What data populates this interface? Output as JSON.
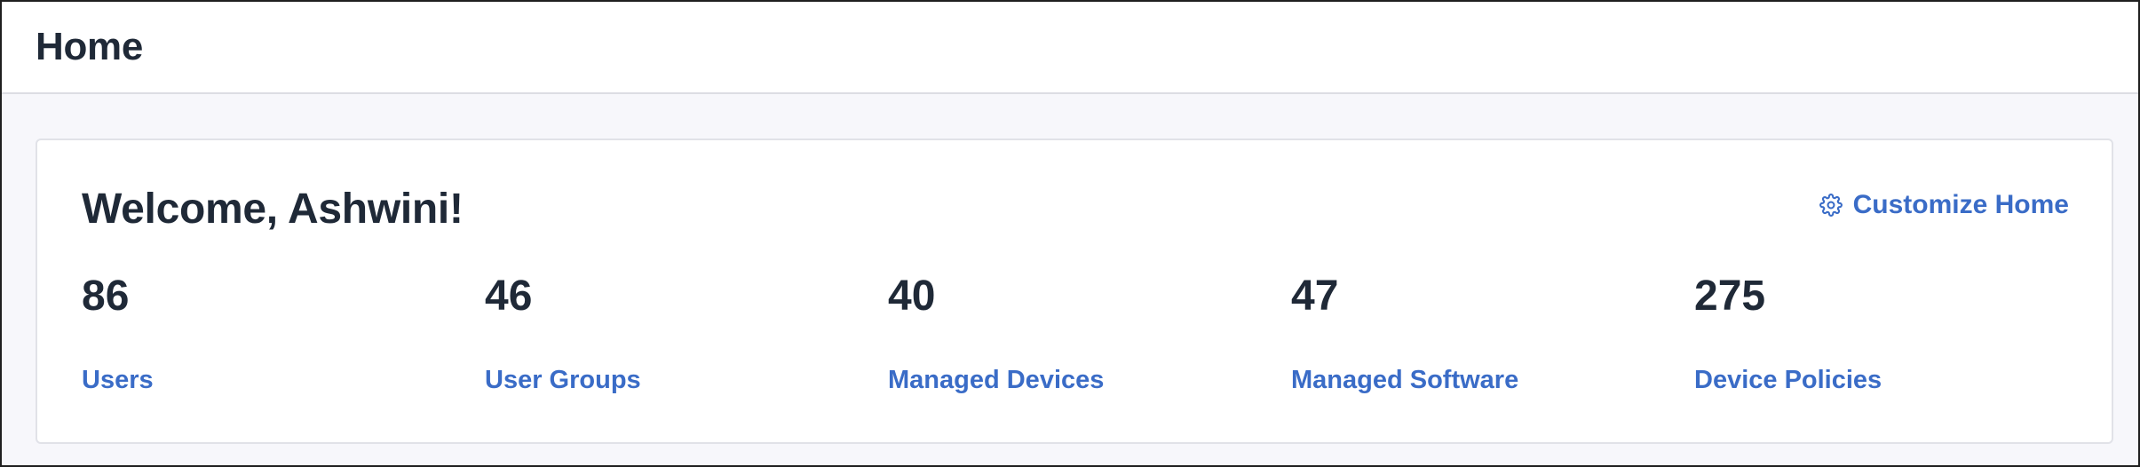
{
  "header": {
    "title": "Home"
  },
  "welcome_card": {
    "greeting": "Welcome, Ashwini!",
    "customize_label": "Customize Home",
    "customize_icon": "gear-icon",
    "accent_color": "#3a6cc7",
    "stats": [
      {
        "value": "86",
        "label": "Users"
      },
      {
        "value": "46",
        "label": "User Groups"
      },
      {
        "value": "40",
        "label": "Managed Devices"
      },
      {
        "value": "47",
        "label": "Managed Software"
      },
      {
        "value": "275",
        "label": "Device Policies"
      }
    ]
  }
}
